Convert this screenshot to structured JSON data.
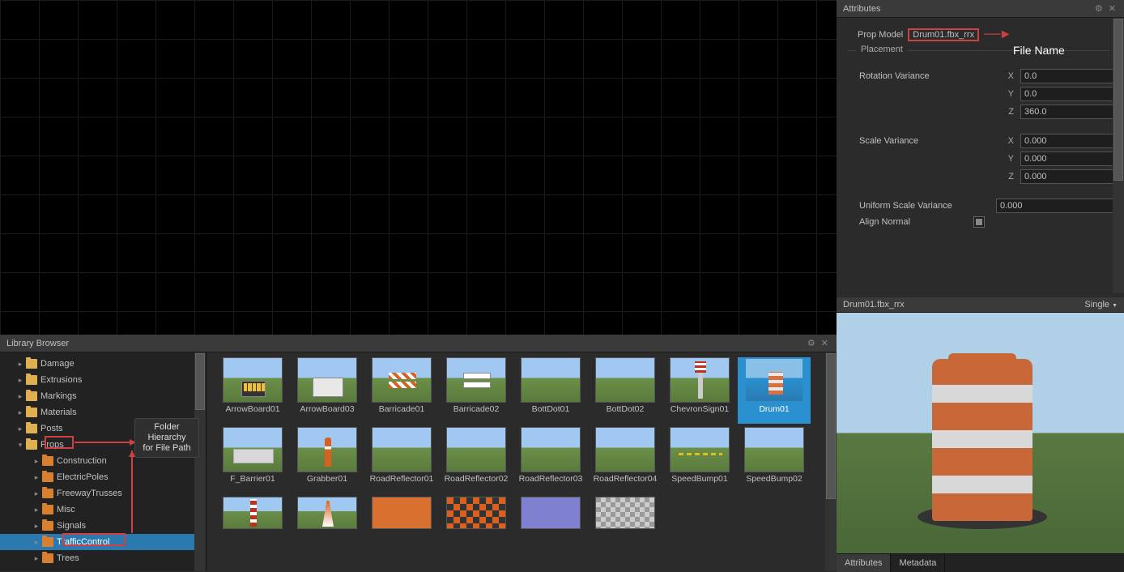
{
  "viewport": {},
  "library": {
    "title": "Library Browser",
    "tree": [
      {
        "label": "Damage",
        "depth": 1
      },
      {
        "label": "Extrusions",
        "depth": 1
      },
      {
        "label": "Markings",
        "depth": 1
      },
      {
        "label": "Materials",
        "depth": 1
      },
      {
        "label": "Posts",
        "depth": 1
      },
      {
        "label": "Props",
        "depth": 1,
        "expanded": true,
        "highlight": true
      },
      {
        "label": "Construction",
        "depth": 2
      },
      {
        "label": "ElectricPoles",
        "depth": 2
      },
      {
        "label": "FreewayTrusses",
        "depth": 2
      },
      {
        "label": "Misc",
        "depth": 2
      },
      {
        "label": "Signals",
        "depth": 2
      },
      {
        "label": "TrafficControl",
        "depth": 2,
        "selected": true,
        "highlight": true
      },
      {
        "label": "Trees",
        "depth": 2
      }
    ],
    "thumbs": [
      {
        "label": "ArrowBoard01"
      },
      {
        "label": "ArrowBoard03"
      },
      {
        "label": "Barricade01"
      },
      {
        "label": "Barricade02"
      },
      {
        "label": "BottDot01"
      },
      {
        "label": "BottDot02"
      },
      {
        "label": "ChevronSign01"
      },
      {
        "label": "Drum01",
        "selected": true
      },
      {
        "label": "F_Barrier01"
      },
      {
        "label": "Grabber01"
      },
      {
        "label": "RoadReflector01"
      },
      {
        "label": "RoadReflector02"
      },
      {
        "label": "RoadReflector03"
      },
      {
        "label": "RoadReflector04"
      },
      {
        "label": "SpeedBump01"
      },
      {
        "label": "SpeedBump02"
      },
      {
        "label": ""
      },
      {
        "label": ""
      },
      {
        "label": ""
      },
      {
        "label": ""
      },
      {
        "label": ""
      },
      {
        "label": ""
      }
    ]
  },
  "attributes": {
    "title": "Attributes",
    "prop_model_label": "Prop Model",
    "prop_model_value": "Drum01.fbx_rrx",
    "file_name_label": "File Name",
    "placement_label": "Placement",
    "rotation_variance_label": "Rotation Variance",
    "rotation_variance": {
      "x": "0.0",
      "y": "0.0",
      "z": "360.0"
    },
    "scale_variance_label": "Scale Variance",
    "scale_variance": {
      "x": "0.000",
      "y": "0.000",
      "z": "0.000"
    },
    "uniform_scale_label": "Uniform Scale Variance",
    "uniform_scale_value": "0.000",
    "align_normal_label": "Align Normal",
    "axes": {
      "x": "X",
      "y": "Y",
      "z": "Z"
    }
  },
  "preview": {
    "title": "Drum01.fbx_rrx",
    "mode": "Single",
    "tabs": {
      "attributes": "Attributes",
      "metadata": "Metadata"
    }
  },
  "annotations": {
    "folder_hierarchy": "Folder\nHierarchy for\nFile Path"
  }
}
